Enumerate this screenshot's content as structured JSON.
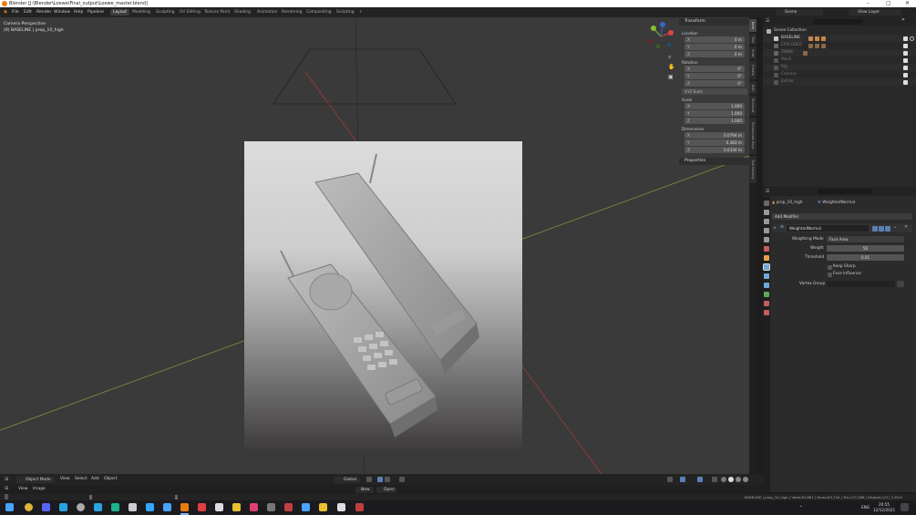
{
  "window": {
    "title": "Blender [J:\\Blender\\Loewe\\Final_output\\Loewe_master.blend]",
    "controls": [
      "–",
      "▢",
      "✕"
    ]
  },
  "menu": {
    "items": [
      "File",
      "Edit",
      "Render",
      "Window",
      "Help",
      "Pipeline"
    ],
    "workspaces": [
      "Layout",
      "Modeling",
      "Sculpting",
      "UV Editing",
      "Texture Paint",
      "Shading",
      "Animation",
      "Rendering",
      "Compositing",
      "Scripting"
    ],
    "add_tab": "+",
    "scene": "Scene",
    "view_layer": "View Layer"
  },
  "viewport": {
    "perspective_label": "Camera Perspective",
    "object_label": "(9) BASELINE | prop_10_high",
    "nav_axes": [
      "X",
      "Y",
      "Z"
    ]
  },
  "transform_panel": {
    "header": "Transform",
    "location_label": "Location",
    "location": [
      {
        "axis": "X",
        "value": "0 m"
      },
      {
        "axis": "Y",
        "value": "0 m"
      },
      {
        "axis": "Z",
        "value": "0 m"
      }
    ],
    "rotation_label": "Rotation",
    "rotation": [
      {
        "axis": "X",
        "value": "0°"
      },
      {
        "axis": "Y",
        "value": "0°"
      },
      {
        "axis": "Z",
        "value": "0°"
      }
    ],
    "rotation_mode": "XYZ Euler",
    "scale_label": "Scale",
    "scale": [
      {
        "axis": "X",
        "value": "1.000"
      },
      {
        "axis": "Y",
        "value": "1.000"
      },
      {
        "axis": "Z",
        "value": "1.000"
      }
    ],
    "dimensions_label": "Dimensions",
    "dimensions": [
      {
        "axis": "X",
        "value": "0.0794 m"
      },
      {
        "axis": "Y",
        "value": "0.383 m"
      },
      {
        "axis": "Z",
        "value": "0.0334 m"
      }
    ],
    "properties_header": "Properties"
  },
  "n_tabs": [
    "Item",
    "Tool",
    "View",
    "Create",
    "Edit",
    "Shortcut",
    "Screencast Keys",
    "Tool Density"
  ],
  "outliner": {
    "collection": "Scene Collection",
    "rows": [
      {
        "name": "BASELINE",
        "color": "#e0e0e0"
      },
      {
        "name": "EXPLODED",
        "color": "#7a7a7a"
      },
      {
        "name": "ZINNE",
        "color": "#7a7a7a"
      },
      {
        "name": "Mesh",
        "color": "#7a7a7a"
      },
      {
        "name": "Rig",
        "color": "#7a7a7a"
      },
      {
        "name": "Camera",
        "color": "#7a7a7a"
      },
      {
        "name": "Extras",
        "color": "#7a7a7a"
      }
    ]
  },
  "properties": {
    "object_name": "prop_10_high",
    "modifier_tab": "WeightedNormal",
    "add_modifier": "Add Modifier",
    "modifier_name": "WeightedNormal",
    "weighting_mode_label": "Weighting Mode",
    "weighting_mode": "Face Area",
    "weight_label": "Weight",
    "weight": "50",
    "threshold_label": "Threshold",
    "threshold": "0.01",
    "keep_sharp": "Keep Sharp",
    "face_influence": "Face Influence",
    "vertex_group_label": "Vertex Group"
  },
  "viewport_footer": {
    "mode": "Object Mode",
    "menus": [
      "View",
      "Select",
      "Add",
      "Object"
    ],
    "transform_orientation": "Global"
  },
  "timeline": {
    "menus": [
      "View",
      "Image"
    ],
    "new_label": "New",
    "open_label": "Open"
  },
  "status": {
    "text": "BASELINE | prop_10_high | Verts:63,881 | Faces:63,744 | Tris:127,488 | Objects:1/3 | 2.93.6"
  },
  "taskbar": {
    "lang": "ENG",
    "time": "20:55",
    "date": "12/12/2021",
    "accent": "#7fb3ff"
  }
}
